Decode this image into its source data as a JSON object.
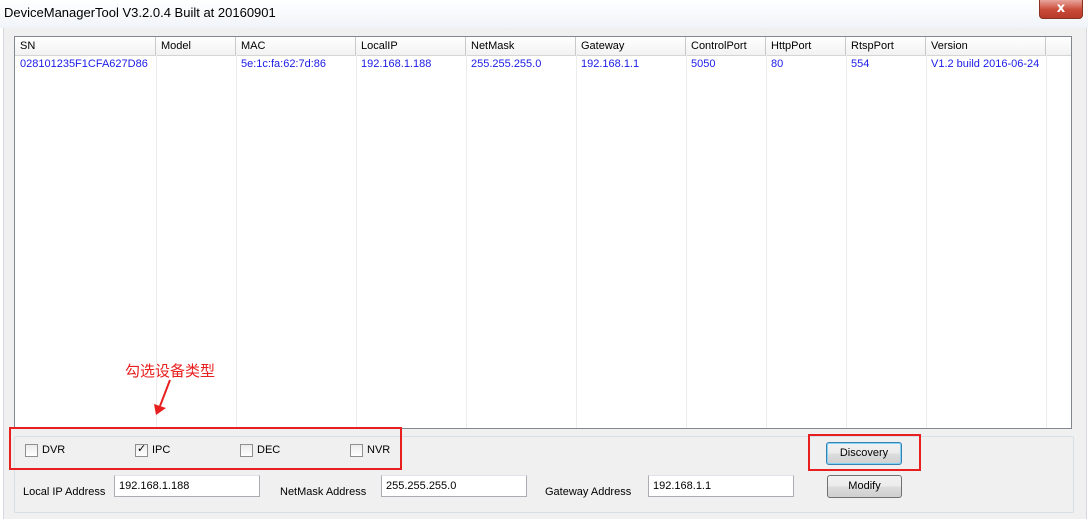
{
  "window": {
    "title": "DeviceManagerTool V3.2.0.4 Built at 20160901",
    "close_glyph": "x"
  },
  "table": {
    "columns": [
      "SN",
      "Model",
      "MAC",
      "LocalIP",
      "NetMask",
      "Gateway",
      "ControlPort",
      "HttpPort",
      "RtspPort",
      "Version"
    ],
    "rows": [
      [
        "028101235F1CFA627D86",
        "",
        "5e:1c:fa:62:7d:86",
        "192.168.1.188",
        "255.255.255.0",
        "192.168.1.1",
        "5050",
        "80",
        "554",
        "V1.2 build 2016-06-24"
      ]
    ]
  },
  "annotation": {
    "text": "勾选设备类型",
    "color": "#e81f1f"
  },
  "device_types": [
    {
      "label": "DVR",
      "checked": false
    },
    {
      "label": "IPC",
      "checked": true
    },
    {
      "label": "DEC",
      "checked": false
    },
    {
      "label": "NVR",
      "checked": false
    }
  ],
  "check_glyph": "✓",
  "buttons": {
    "discovery": "Discovery",
    "modify": "Modify"
  },
  "fields": {
    "local_ip": {
      "label": "Local IP Address",
      "value": "192.168.1.188"
    },
    "netmask": {
      "label": "NetMask Address",
      "value": "255.255.255.0"
    },
    "gateway": {
      "label": "Gateway Address",
      "value": "192.168.1.1"
    }
  },
  "colors": {
    "row_text": "#1a1ae6",
    "highlight": "#e81f1f"
  }
}
